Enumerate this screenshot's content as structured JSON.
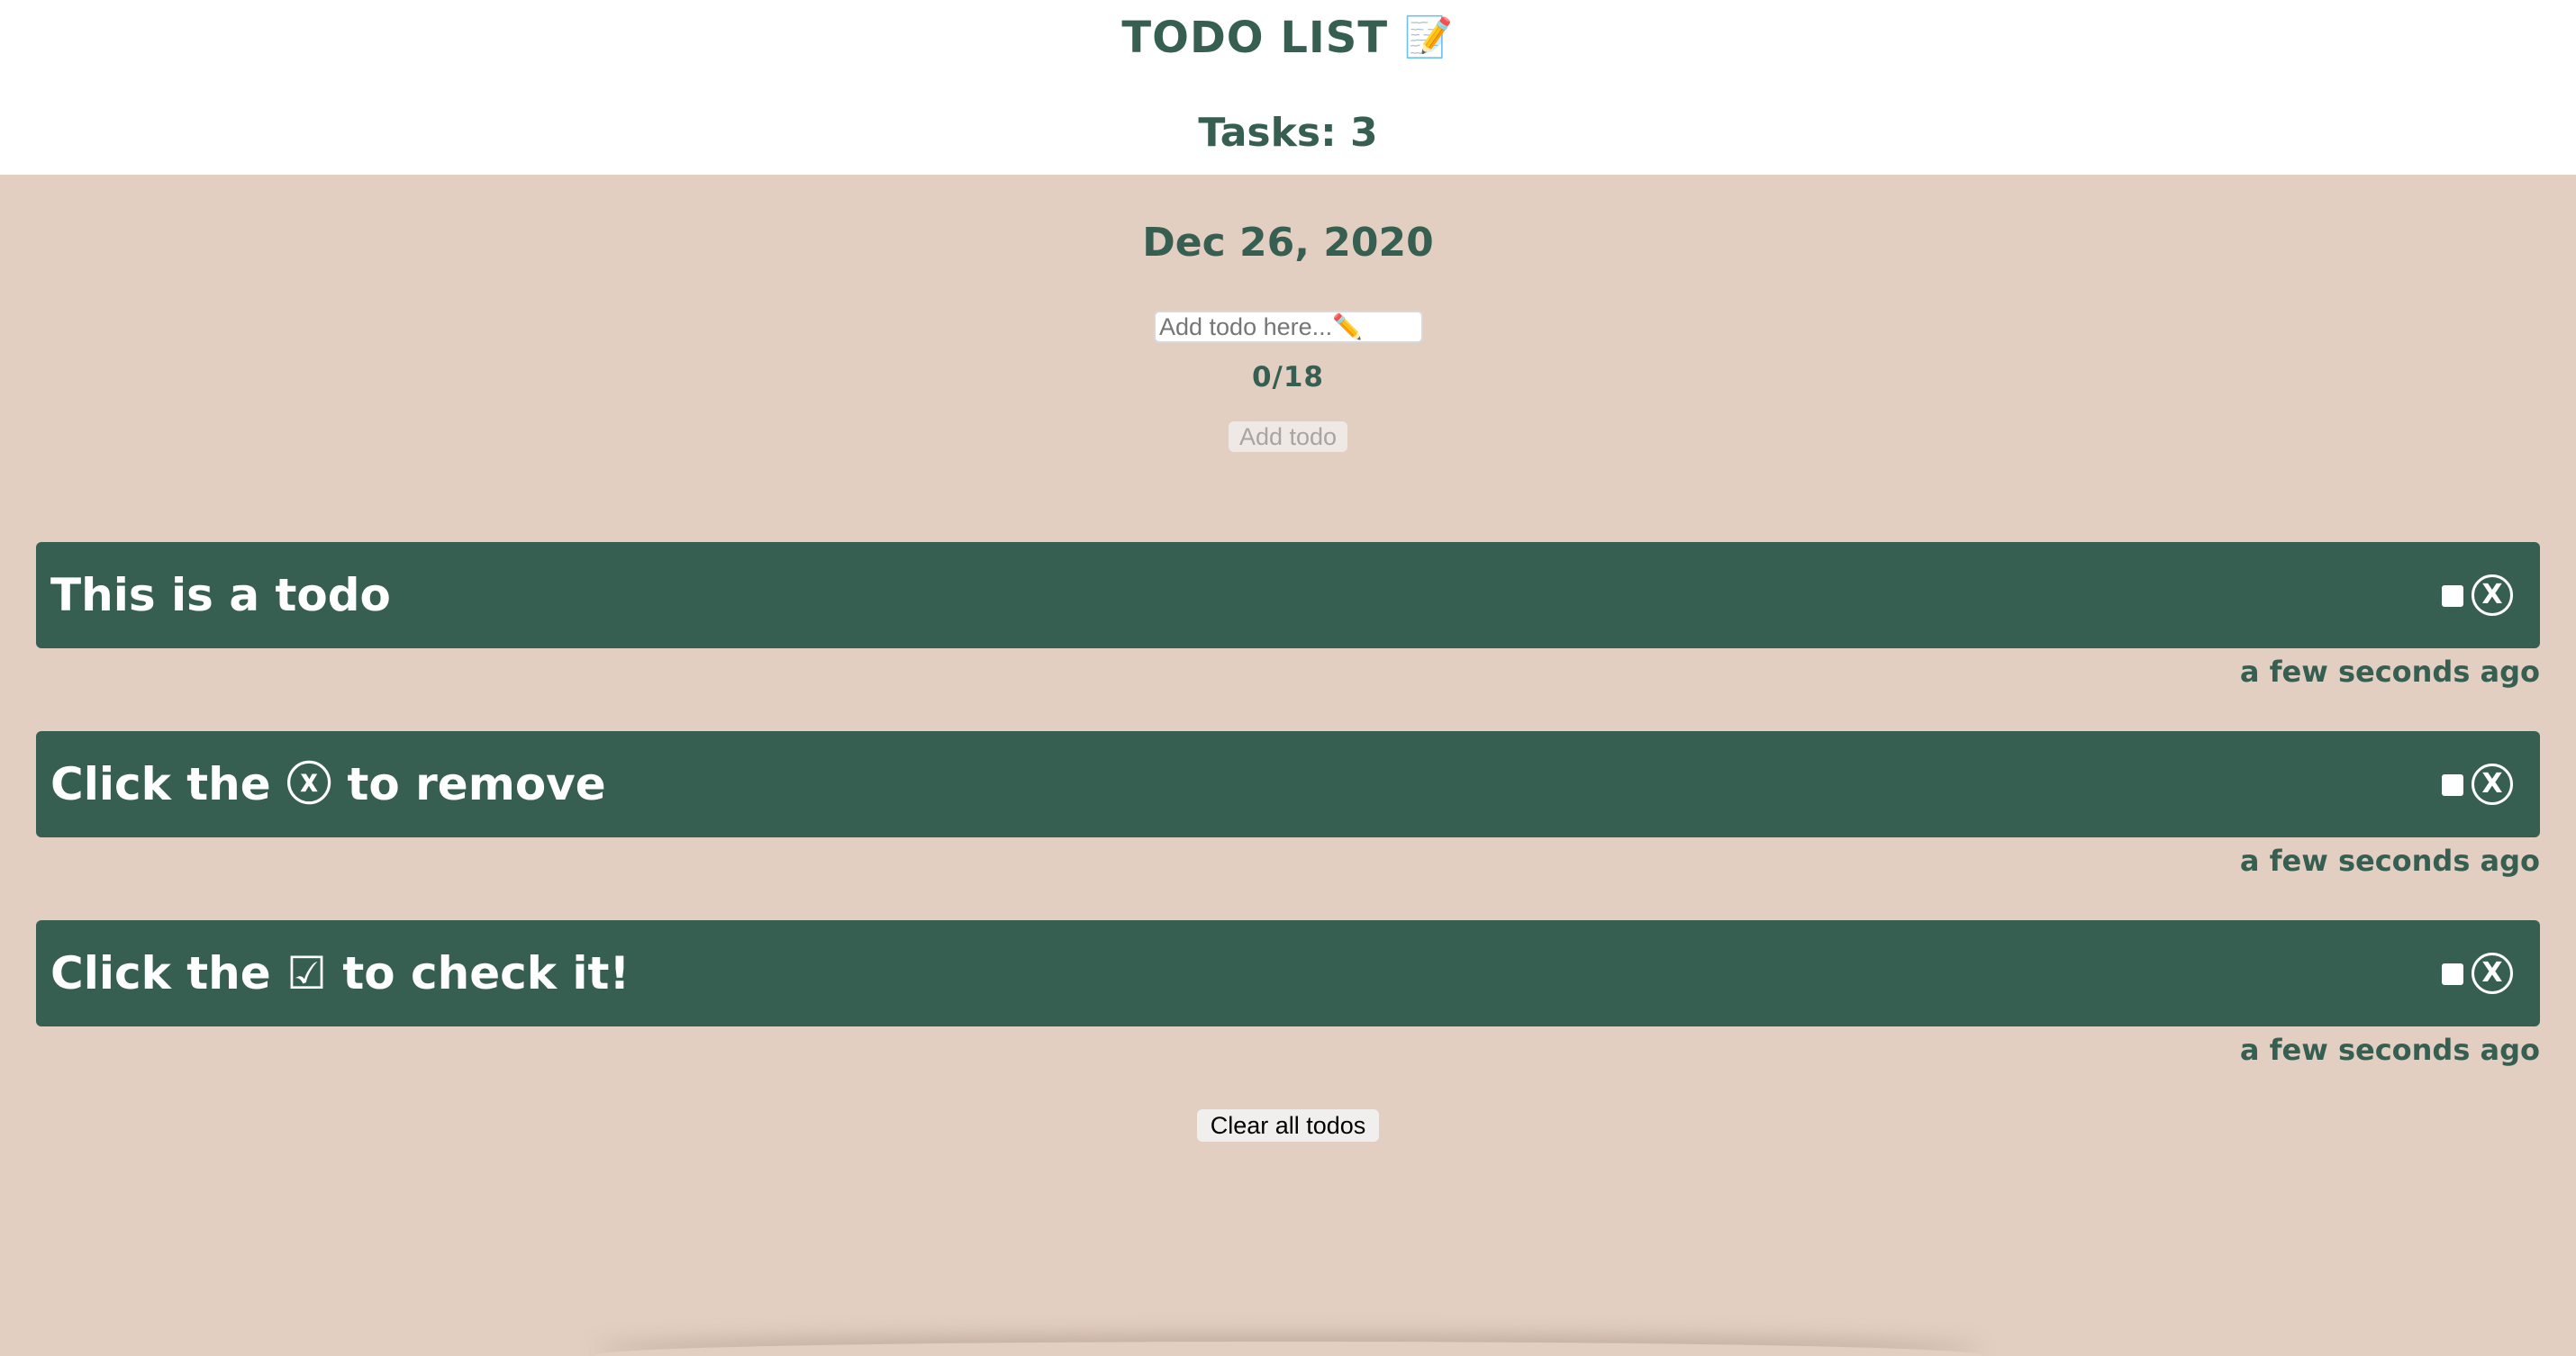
{
  "header": {
    "title": "TODO LIST",
    "title_emoji": "📝",
    "task_count": "Tasks: 3"
  },
  "main": {
    "date": "Dec 26, 2020",
    "input": {
      "placeholder": "Add todo here...✏️",
      "value": ""
    },
    "char_counter": "0/18",
    "add_button_label": "Add todo",
    "clear_button_label": "Clear all todos"
  },
  "todos": [
    {
      "text": "This is a todo",
      "time": "a few seconds ago",
      "checked": false
    },
    {
      "text": "Click the ⓧ to remove",
      "time": "a few seconds ago",
      "checked": false
    },
    {
      "text": "Click the ☑ to check it!",
      "time": "a few seconds ago",
      "checked": false
    }
  ],
  "icons": {
    "remove": "ⓧ"
  },
  "colors": {
    "primary": "#365f52",
    "background": "#e3cfc2",
    "header_background": "#ffffff"
  }
}
